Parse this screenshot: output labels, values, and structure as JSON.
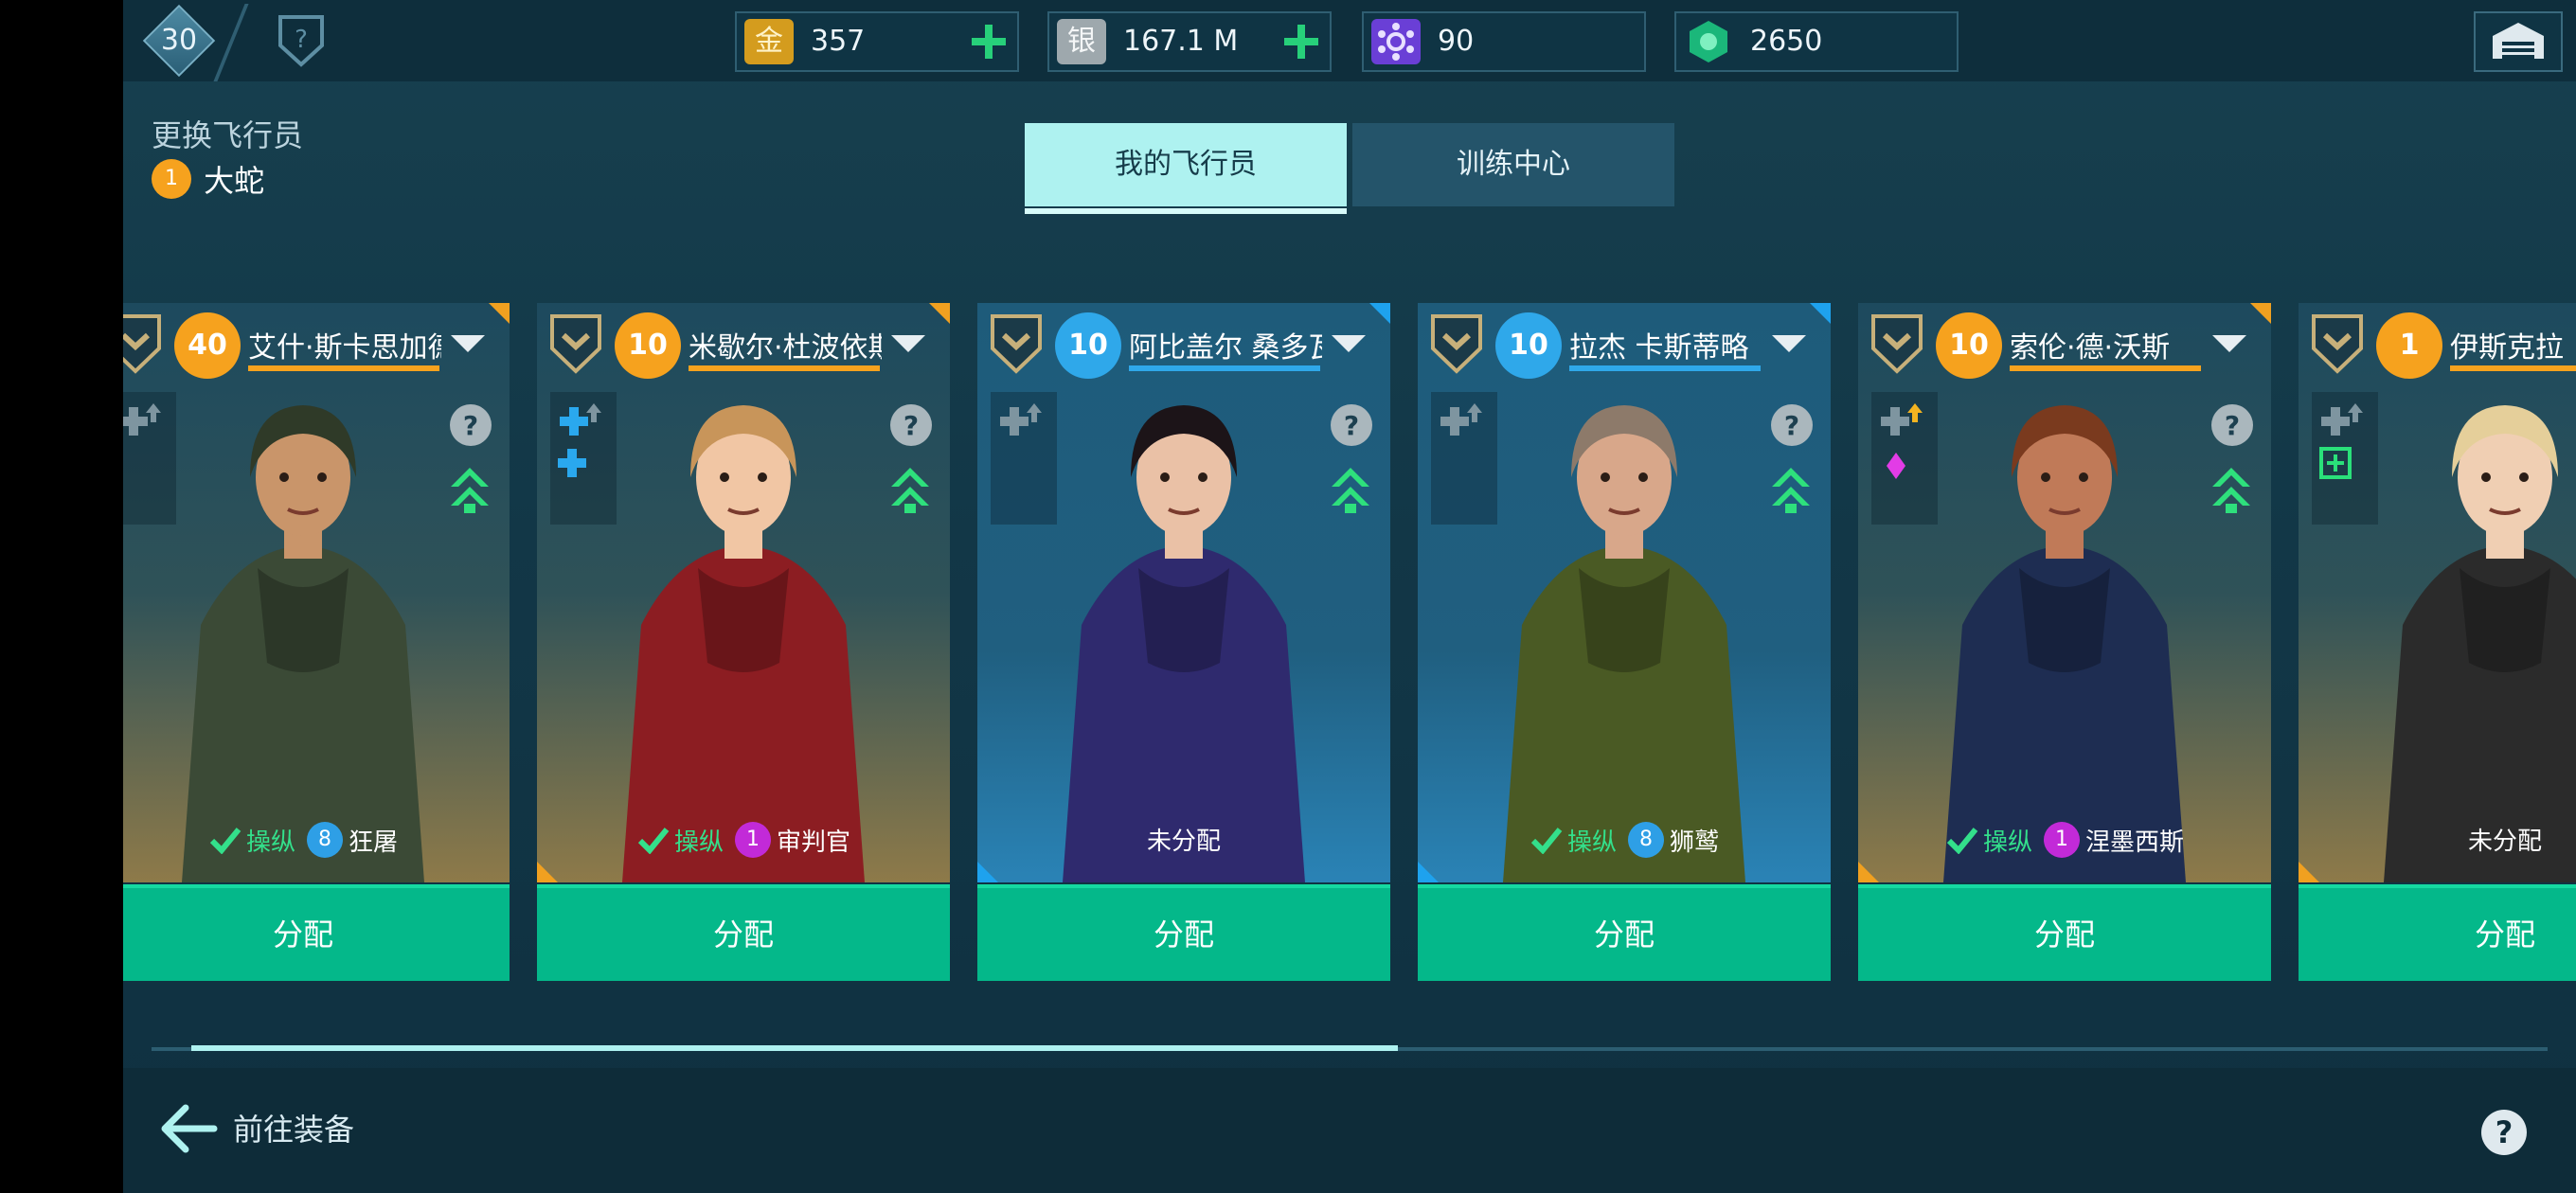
{
  "header": {
    "rank_level": "30",
    "resources": [
      {
        "icon": "gold-icon",
        "glyph": "金",
        "value": "357",
        "has_plus": true
      },
      {
        "icon": "silver-icon",
        "glyph": "银",
        "value": "167.1 M",
        "has_plus": true
      },
      {
        "icon": "molecule-icon",
        "glyph": "",
        "value": "90",
        "has_plus": false
      },
      {
        "icon": "emerald-icon",
        "glyph": "",
        "value": "2650",
        "has_plus": false
      }
    ]
  },
  "page": {
    "title": "更换飞行员",
    "current_pilot": {
      "badge": "1",
      "name": "大蛇"
    }
  },
  "tabs": [
    {
      "label": "我的飞行员",
      "active": true
    },
    {
      "label": "训练中心",
      "active": false
    }
  ],
  "pilots": [
    {
      "level": "40",
      "name": "艾什·斯卡思加德",
      "rarity": "gold",
      "status": {
        "assigned": true,
        "control": "操纵",
        "class_badge": "8",
        "class_badge_color": "#2e9fe6",
        "class_name": "狂屠"
      },
      "assign_label": "分配"
    },
    {
      "level": "10",
      "name": "米歇尔·杜波依斯",
      "rarity": "gold",
      "status": {
        "assigned": true,
        "control": "操纵",
        "class_badge": "1",
        "class_badge_color": "#c22ad8",
        "class_name": "审判官"
      },
      "assign_label": "分配"
    },
    {
      "level": "10",
      "name": "阿比盖尔 桑多瓦尔",
      "rarity": "blue",
      "status": {
        "assigned": false,
        "text": "未分配"
      },
      "assign_label": "分配"
    },
    {
      "level": "10",
      "name": "拉杰 卡斯蒂略",
      "rarity": "blue",
      "status": {
        "assigned": true,
        "control": "操纵",
        "class_badge": "8",
        "class_badge_color": "#2e9fe6",
        "class_name": "狮鹫"
      },
      "assign_label": "分配"
    },
    {
      "level": "10",
      "name": "索伦·德·沃斯",
      "rarity": "gold",
      "status": {
        "assigned": true,
        "control": "操纵",
        "class_badge": "1",
        "class_badge_color": "#c22ad8",
        "class_name": "涅墨西斯"
      },
      "assign_label": "分配"
    },
    {
      "level": "1",
      "name": "伊斯克拉",
      "rarity": "gold",
      "status": {
        "assigned": false,
        "text": "未分配"
      },
      "assign_label": "分配"
    }
  ],
  "scroll_position": 0.29,
  "footer": {
    "back_label": "前往装备"
  },
  "colors": {
    "accent_green": "#04b88a",
    "gold": "#f6a21e",
    "blue": "#2fa8ea",
    "tab_active": "#aef2f0"
  }
}
